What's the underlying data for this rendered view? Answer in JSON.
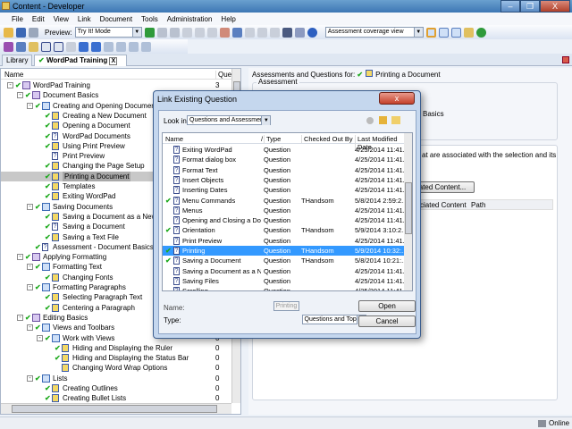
{
  "window": {
    "title": "Content - Developer",
    "min": "–",
    "max": "❐",
    "close": "X"
  },
  "menu": [
    "File",
    "Edit",
    "View",
    "Link",
    "Document",
    "Tools",
    "Administration",
    "Help"
  ],
  "toolbar": {
    "preview_label": "Preview:",
    "preview_mode": "Try It! Mode",
    "view_select": "Assessment coverage view"
  },
  "tabs": {
    "library": "Library",
    "wordpad": "WordPad Training",
    "close": "X"
  },
  "tree": {
    "header_name": "Name",
    "header_count": "Quest",
    "rows": [
      {
        "label": "WordPad Training",
        "level": 0,
        "icon": "book",
        "check": true,
        "toggle": "-",
        "count": "3"
      },
      {
        "label": "Document Basics",
        "level": 1,
        "icon": "book",
        "check": true,
        "toggle": "-",
        "count": ""
      },
      {
        "label": "Creating and Opening Documents",
        "level": 2,
        "icon": "openbook",
        "check": true,
        "toggle": "-",
        "count": ""
      },
      {
        "label": "Creating a New Document",
        "level": 3,
        "icon": "topic",
        "check": true,
        "count": ""
      },
      {
        "label": "Opening a Document",
        "level": 3,
        "icon": "topic",
        "check": true,
        "count": ""
      },
      {
        "label": "WordPad Documents",
        "level": 3,
        "icon": "question",
        "check": true,
        "count": ""
      },
      {
        "label": "Using Print Preview",
        "level": 3,
        "icon": "topic",
        "check": true,
        "count": ""
      },
      {
        "label": "Print Preview",
        "level": 3,
        "icon": "question",
        "check": false,
        "count": ""
      },
      {
        "label": "Changing the Page Setup",
        "level": 3,
        "icon": "topic",
        "check": true,
        "count": ""
      },
      {
        "label": "Printing a Document",
        "level": 3,
        "icon": "topic",
        "check": true,
        "count": "",
        "selected": true
      },
      {
        "label": "Templates",
        "level": 3,
        "icon": "topic",
        "check": true,
        "count": ""
      },
      {
        "label": "Exiting WordPad",
        "level": 3,
        "icon": "topic",
        "check": true,
        "count": ""
      },
      {
        "label": "Saving Documents",
        "level": 2,
        "icon": "openbook",
        "check": true,
        "toggle": "-",
        "count": ""
      },
      {
        "label": "Saving a Document as a New File",
        "level": 3,
        "icon": "topic",
        "check": true,
        "count": ""
      },
      {
        "label": "Saving a Document",
        "level": 3,
        "icon": "question",
        "check": true,
        "count": ""
      },
      {
        "label": "Saving a Text File",
        "level": 3,
        "icon": "topic",
        "check": true,
        "count": ""
      },
      {
        "label": "Assessment - Document Basics",
        "level": 2,
        "icon": "question",
        "check": true,
        "count": ""
      },
      {
        "label": "Applying Formatting",
        "level": 1,
        "icon": "book",
        "check": true,
        "toggle": "-",
        "count": ""
      },
      {
        "label": "Formatting Text",
        "level": 2,
        "icon": "openbook",
        "check": true,
        "toggle": "-",
        "count": ""
      },
      {
        "label": "Changing Fonts",
        "level": 3,
        "icon": "topic",
        "check": true,
        "count": ""
      },
      {
        "label": "Formatting Paragraphs",
        "level": 2,
        "icon": "openbook",
        "check": true,
        "toggle": "-",
        "count": ""
      },
      {
        "label": "Selecting Paragraph Text",
        "level": 3,
        "icon": "topic",
        "check": true,
        "count": ""
      },
      {
        "label": "Centering a Paragraph",
        "level": 3,
        "icon": "topic",
        "check": true,
        "count": ""
      },
      {
        "label": "Editing Basics",
        "level": 1,
        "icon": "book",
        "check": true,
        "toggle": "-",
        "count": ""
      },
      {
        "label": "Views and Toolbars",
        "level": 2,
        "icon": "openbook",
        "check": true,
        "toggle": "-",
        "count": ""
      },
      {
        "label": "Work with Views",
        "level": 3,
        "icon": "openbook",
        "check": true,
        "toggle": "-",
        "count": "0"
      },
      {
        "label": "Hiding and Displaying the Ruler",
        "level": 4,
        "icon": "topic",
        "check": true,
        "count": "0"
      },
      {
        "label": "Hiding and Displaying the Status Bar",
        "level": 4,
        "icon": "topic",
        "check": true,
        "count": "0"
      },
      {
        "label": "Changing Word Wrap Options",
        "level": 4,
        "icon": "topic",
        "check": false,
        "count": "0"
      },
      {
        "label": "Lists",
        "level": 2,
        "icon": "openbook",
        "check": true,
        "toggle": "-",
        "count": "0"
      },
      {
        "label": "Creating Outlines",
        "level": 3,
        "icon": "topic",
        "check": true,
        "count": "0"
      },
      {
        "label": "Creating Bullet Lists",
        "level": 3,
        "icon": "topic",
        "check": true,
        "count": "0"
      }
    ]
  },
  "right": {
    "for_label": "Assessments and Questions for:",
    "for_value": "Printing a Document",
    "assessment_group": "Assessment",
    "partial_basics": "Basics",
    "partial_desc": "at are associated with the selection and its",
    "partial_button": "ated Content...",
    "col_partial": "ciated Content",
    "col_path": "Path"
  },
  "dialog": {
    "title": "Link Existing Question",
    "close": "x",
    "look_in_label": "Look in:",
    "look_in_value": "Questions and Assessments",
    "columns": [
      "Name",
      "Type",
      "Checked Out By",
      "Last Modified Date"
    ],
    "rows": [
      {
        "name": "Exiting WordPad",
        "type": "Question",
        "by": "",
        "date": "4/25/2014 11:41...",
        "check": false
      },
      {
        "name": "Format dialog box",
        "type": "Question",
        "by": "",
        "date": "4/25/2014 11:41...",
        "check": false
      },
      {
        "name": "Format Text",
        "type": "Question",
        "by": "",
        "date": "4/25/2014 11:41...",
        "check": false
      },
      {
        "name": "Insert Objects",
        "type": "Question",
        "by": "",
        "date": "4/25/2014 11:41...",
        "check": false
      },
      {
        "name": "Inserting Dates",
        "type": "Question",
        "by": "",
        "date": "4/25/2014 11:41...",
        "check": false
      },
      {
        "name": "Menu Commands",
        "type": "Question",
        "by": "THandsom",
        "date": "5/8/2014 2:59:2...",
        "check": true
      },
      {
        "name": "Menus",
        "type": "Question",
        "by": "",
        "date": "4/25/2014 11:41...",
        "check": false
      },
      {
        "name": "Opening and Closing a Docu...",
        "type": "Question",
        "by": "",
        "date": "4/25/2014 11:41...",
        "check": false
      },
      {
        "name": "Orientation",
        "type": "Question",
        "by": "THandsom",
        "date": "5/9/2014 3:10:2...",
        "check": true
      },
      {
        "name": "Print Preview",
        "type": "Question",
        "by": "",
        "date": "4/25/2014 11:41...",
        "check": false
      },
      {
        "name": "Printing",
        "type": "Question",
        "by": "THandsom",
        "date": "5/9/2014 10:32:...",
        "check": true,
        "selected": true
      },
      {
        "name": "Saving a Document",
        "type": "Question",
        "by": "THandsom",
        "date": "5/8/2014 10:21:...",
        "check": true
      },
      {
        "name": "Saving a Document as a Ne...",
        "type": "Question",
        "by": "",
        "date": "4/25/2014 11:41...",
        "check": false
      },
      {
        "name": "Saving Files",
        "type": "Question",
        "by": "",
        "date": "4/25/2014 11:41...",
        "check": false
      },
      {
        "name": "Scrolling",
        "type": "Question",
        "by": "",
        "date": "4/25/2014 11:41...",
        "check": false
      }
    ],
    "name_label": "Name:",
    "name_value": "Printing",
    "type_label": "Type:",
    "type_value": "Questions and Topics",
    "open": "Open",
    "cancel": "Cancel"
  },
  "status": {
    "online": "Online"
  }
}
